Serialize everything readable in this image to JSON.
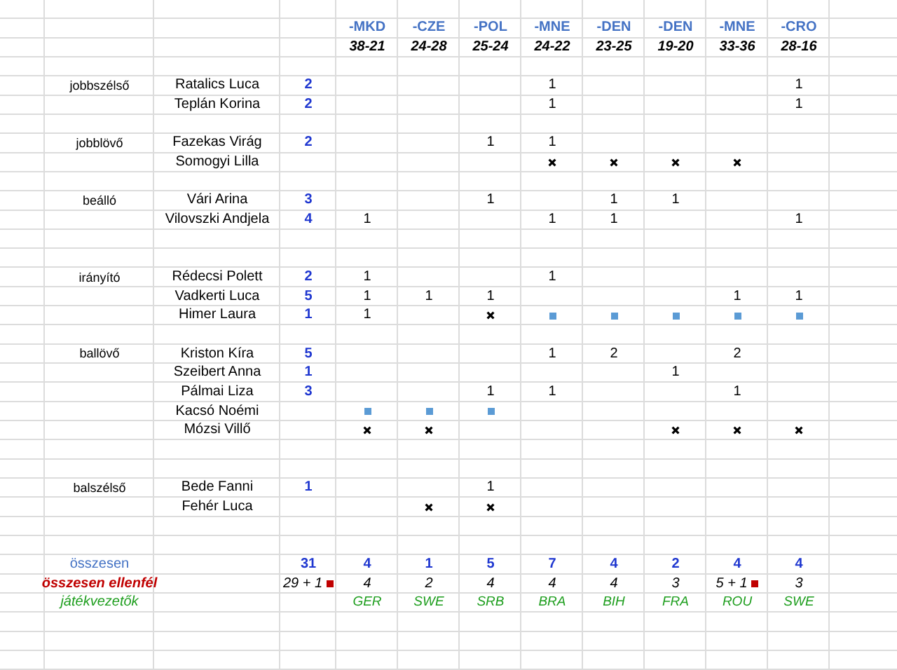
{
  "matches": [
    {
      "team": "-MKD",
      "score": "38-21"
    },
    {
      "team": "-CZE",
      "score": "24-28"
    },
    {
      "team": "-POL",
      "score": "25-24"
    },
    {
      "team": "-MNE",
      "score": "24-22"
    },
    {
      "team": "-DEN",
      "score": "23-25"
    },
    {
      "team": "-DEN",
      "score": "19-20"
    },
    {
      "team": "-MNE",
      "score": "33-36"
    },
    {
      "team": "-CRO",
      "score": "28-16"
    }
  ],
  "rows": [
    {
      "kind": "blank"
    },
    {
      "kind": "teams"
    },
    {
      "kind": "scores"
    },
    {
      "kind": "blank"
    },
    {
      "kind": "player",
      "position": "jobbszélső",
      "name": "Ratalics Luca",
      "goals": "2",
      "cells": [
        {
          "kind": "empty"
        },
        {
          "kind": "empty"
        },
        {
          "kind": "empty"
        },
        {
          "kind": "goals",
          "value": "1"
        },
        {
          "kind": "empty"
        },
        {
          "kind": "empty"
        },
        {
          "kind": "empty"
        },
        {
          "kind": "goals",
          "value": "1"
        }
      ]
    },
    {
      "kind": "player",
      "name": "Teplán Korina",
      "goals": "2",
      "cells": [
        {
          "kind": "empty"
        },
        {
          "kind": "empty"
        },
        {
          "kind": "empty"
        },
        {
          "kind": "goals",
          "value": "1"
        },
        {
          "kind": "empty"
        },
        {
          "kind": "empty"
        },
        {
          "kind": "empty"
        },
        {
          "kind": "goals",
          "value": "1"
        }
      ]
    },
    {
      "kind": "blank"
    },
    {
      "kind": "player",
      "position": "jobblövő",
      "name": "Fazekas Virág",
      "goals": "2",
      "cells": [
        {
          "kind": "empty"
        },
        {
          "kind": "empty"
        },
        {
          "kind": "goals",
          "value": "1"
        },
        {
          "kind": "goals",
          "value": "1"
        },
        {
          "kind": "empty"
        },
        {
          "kind": "empty"
        },
        {
          "kind": "empty"
        },
        {
          "kind": "empty"
        }
      ]
    },
    {
      "kind": "player",
      "name": "Somogyi Lilla",
      "cells": [
        {
          "kind": "empty"
        },
        {
          "kind": "empty"
        },
        {
          "kind": "empty"
        },
        {
          "kind": "cross"
        },
        {
          "kind": "cross"
        },
        {
          "kind": "cross"
        },
        {
          "kind": "cross"
        },
        {
          "kind": "empty"
        }
      ]
    },
    {
      "kind": "blank"
    },
    {
      "kind": "player",
      "position": "beálló",
      "name": "Vári Arina",
      "goals": "3",
      "cells": [
        {
          "kind": "empty"
        },
        {
          "kind": "empty"
        },
        {
          "kind": "goals",
          "value": "1"
        },
        {
          "kind": "empty"
        },
        {
          "kind": "goals",
          "value": "1"
        },
        {
          "kind": "goals",
          "value": "1"
        },
        {
          "kind": "empty"
        },
        {
          "kind": "empty"
        }
      ]
    },
    {
      "kind": "player",
      "name": "Vilovszki Andjela",
      "goals": "4",
      "cells": [
        {
          "kind": "goals",
          "value": "1"
        },
        {
          "kind": "empty"
        },
        {
          "kind": "empty"
        },
        {
          "kind": "goals",
          "value": "1"
        },
        {
          "kind": "goals",
          "value": "1"
        },
        {
          "kind": "empty"
        },
        {
          "kind": "empty"
        },
        {
          "kind": "goals",
          "value": "1"
        }
      ]
    },
    {
      "kind": "blank"
    },
    {
      "kind": "blank"
    },
    {
      "kind": "player",
      "position": "irányító",
      "name": "Rédecsi Polett",
      "goals": "2",
      "cells": [
        {
          "kind": "goals",
          "value": "1"
        },
        {
          "kind": "empty"
        },
        {
          "kind": "empty"
        },
        {
          "kind": "goals",
          "value": "1"
        },
        {
          "kind": "empty"
        },
        {
          "kind": "empty"
        },
        {
          "kind": "empty"
        },
        {
          "kind": "empty"
        }
      ]
    },
    {
      "kind": "player",
      "name": "Vadkerti  Luca",
      "goals": "5",
      "cells": [
        {
          "kind": "goals",
          "value": "1"
        },
        {
          "kind": "goals",
          "value": "1"
        },
        {
          "kind": "goals",
          "value": "1"
        },
        {
          "kind": "empty"
        },
        {
          "kind": "empty"
        },
        {
          "kind": "empty"
        },
        {
          "kind": "goals",
          "value": "1"
        },
        {
          "kind": "goals",
          "value": "1"
        }
      ]
    },
    {
      "kind": "player",
      "name": "Himer Laura",
      "goals": "1",
      "cells": [
        {
          "kind": "goals",
          "value": "1"
        },
        {
          "kind": "empty"
        },
        {
          "kind": "cross"
        },
        {
          "kind": "square"
        },
        {
          "kind": "square"
        },
        {
          "kind": "square"
        },
        {
          "kind": "square"
        },
        {
          "kind": "square"
        }
      ]
    },
    {
      "kind": "blank"
    },
    {
      "kind": "player",
      "position": "ballövő",
      "name": "Kriston Kíra",
      "goals": "5",
      "cells": [
        {
          "kind": "empty"
        },
        {
          "kind": "empty"
        },
        {
          "kind": "empty"
        },
        {
          "kind": "goals",
          "value": "1"
        },
        {
          "kind": "goals",
          "value": "2"
        },
        {
          "kind": "empty"
        },
        {
          "kind": "goals",
          "value": "2"
        },
        {
          "kind": "empty"
        }
      ]
    },
    {
      "kind": "player",
      "name": "Szeibert Anna",
      "goals": "1",
      "cells": [
        {
          "kind": "empty"
        },
        {
          "kind": "empty"
        },
        {
          "kind": "empty"
        },
        {
          "kind": "empty"
        },
        {
          "kind": "empty"
        },
        {
          "kind": "goals",
          "value": "1"
        },
        {
          "kind": "empty"
        },
        {
          "kind": "empty"
        }
      ]
    },
    {
      "kind": "player",
      "name": "Pálmai Liza",
      "goals": "3",
      "cells": [
        {
          "kind": "empty"
        },
        {
          "kind": "empty"
        },
        {
          "kind": "goals",
          "value": "1"
        },
        {
          "kind": "goals",
          "value": "1"
        },
        {
          "kind": "empty"
        },
        {
          "kind": "empty"
        },
        {
          "kind": "goals",
          "value": "1"
        },
        {
          "kind": "empty"
        }
      ]
    },
    {
      "kind": "player",
      "name": "Kacsó Noémi",
      "cells": [
        {
          "kind": "square"
        },
        {
          "kind": "square"
        },
        {
          "kind": "square"
        },
        {
          "kind": "empty"
        },
        {
          "kind": "empty"
        },
        {
          "kind": "empty"
        },
        {
          "kind": "empty"
        },
        {
          "kind": "empty"
        }
      ]
    },
    {
      "kind": "player",
      "name": "Mózsi Villő",
      "cells": [
        {
          "kind": "cross"
        },
        {
          "kind": "cross"
        },
        {
          "kind": "empty"
        },
        {
          "kind": "empty"
        },
        {
          "kind": "empty"
        },
        {
          "kind": "cross"
        },
        {
          "kind": "cross"
        },
        {
          "kind": "cross"
        }
      ]
    },
    {
      "kind": "blank"
    },
    {
      "kind": "blank"
    },
    {
      "kind": "player",
      "position": "balszélső",
      "name": "Bede Fanni",
      "goals": "1",
      "cells": [
        {
          "kind": "empty"
        },
        {
          "kind": "empty"
        },
        {
          "kind": "goals",
          "value": "1"
        },
        {
          "kind": "empty"
        },
        {
          "kind": "empty"
        },
        {
          "kind": "empty"
        },
        {
          "kind": "empty"
        },
        {
          "kind": "empty"
        }
      ]
    },
    {
      "kind": "player",
      "name": "Fehér Luca",
      "cells": [
        {
          "kind": "empty"
        },
        {
          "kind": "cross"
        },
        {
          "kind": "cross"
        },
        {
          "kind": "empty"
        },
        {
          "kind": "empty"
        },
        {
          "kind": "empty"
        },
        {
          "kind": "empty"
        },
        {
          "kind": "empty"
        }
      ]
    },
    {
      "kind": "blank"
    },
    {
      "kind": "blank"
    },
    {
      "kind": "goals_total",
      "label": "összesen",
      "overall": {
        "text": "31"
      },
      "values": [
        {
          "text": "4"
        },
        {
          "text": "1"
        },
        {
          "text": "5"
        },
        {
          "text": "7"
        },
        {
          "text": "4"
        },
        {
          "text": "2"
        },
        {
          "text": "4"
        },
        {
          "text": "4"
        }
      ]
    },
    {
      "kind": "against_total",
      "label": "összesen ellenfél",
      "overall": {
        "text": "29 + 1",
        "card": true
      },
      "values": [
        {
          "text": "4",
          "card": false
        },
        {
          "text": "2",
          "card": false
        },
        {
          "text": "4",
          "card": false
        },
        {
          "text": "4",
          "card": false
        },
        {
          "text": "4",
          "card": false
        },
        {
          "text": "3",
          "card": false
        },
        {
          "text": "5 + 1",
          "card": true
        },
        {
          "text": "3",
          "card": false
        }
      ]
    },
    {
      "kind": "referees",
      "label": "játékvezetők",
      "values": [
        {
          "text": "GER"
        },
        {
          "text": "SWE"
        },
        {
          "text": "SRB"
        },
        {
          "text": "BRA"
        },
        {
          "text": "BIH"
        },
        {
          "text": "FRA"
        },
        {
          "text": "ROU"
        },
        {
          "text": "SWE"
        }
      ]
    }
  ]
}
